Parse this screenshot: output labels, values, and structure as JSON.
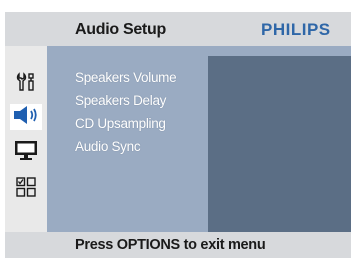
{
  "header": {
    "title": "Audio Setup",
    "brand": "PHILIPS"
  },
  "sidebar": {
    "items": [
      {
        "icon": "general-setup-icon",
        "active": false
      },
      {
        "icon": "audio-speaker-icon",
        "active": true
      },
      {
        "icon": "video-monitor-icon",
        "active": false
      },
      {
        "icon": "preference-grid-icon",
        "active": false
      }
    ]
  },
  "menu": {
    "items": [
      {
        "label": "Speakers Volume"
      },
      {
        "label": "Speakers Delay"
      },
      {
        "label": "CD Upsampling"
      },
      {
        "label": "Audio Sync"
      }
    ]
  },
  "footer": {
    "hint": "Press OPTIONS to exit menu"
  },
  "colors": {
    "header_bg": "#d7d9dc",
    "options_panel_bg": "#9aabc2",
    "value_panel_bg": "#5b6e85",
    "brand": "#2f67a8",
    "active_icon": "#1f5fb0"
  }
}
